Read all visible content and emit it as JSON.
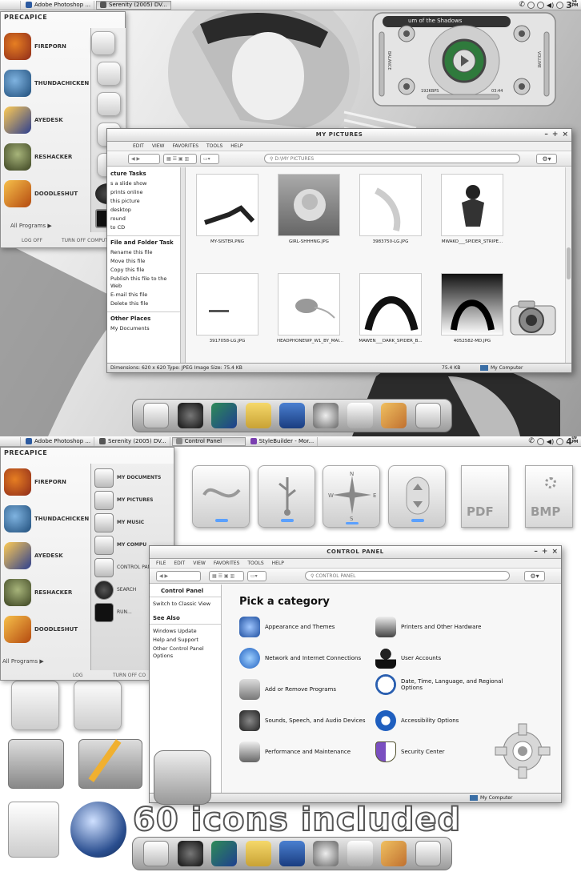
{
  "top": {
    "taskbar": {
      "items": [
        "Adobe Photoshop ...",
        "Serenity (2005) DV..."
      ],
      "clock": {
        "hour": "3",
        "minutes": "54",
        "ampm": "PM"
      }
    },
    "startmenu": {
      "title": "PRECAPICE",
      "items": [
        {
          "label": "FIREPORN",
          "color": "#c0392b"
        },
        {
          "label": "THUNDACHICKEN",
          "color": "#2e6da4"
        },
        {
          "label": "AYEDESK",
          "color": "#2d3f8f"
        },
        {
          "label": "RESHACKER",
          "color": "#6b7a3f"
        },
        {
          "label": "DOODLESHUT",
          "color": "#c66d1f"
        }
      ],
      "all_programs": "All Programs",
      "logoff": "LOG OFF",
      "turnoff": "TURN OFF COMPUTER"
    },
    "player": {
      "track": "um of the Shadows",
      "left_label": "BALANCE",
      "right_label": "VOLUME",
      "bitrate": "192KBPS",
      "time": "03:44"
    },
    "explorer": {
      "title": "MY PICTURES",
      "menu": [
        "EDIT",
        "VIEW",
        "FAVORITES",
        "TOOLS",
        "HELP"
      ],
      "address": "D:\\MY PICTURES",
      "task_heading": "cture Tasks",
      "task_links": [
        "s a slide show",
        "prints online",
        "this picture",
        "desktop",
        "round",
        "to CD"
      ],
      "ff_heading": "File and Folder Task",
      "ff_links": [
        "Rename this file",
        "Move this file",
        "Copy this file",
        "Publish this file to the Web",
        "E-mail this file",
        "Delete this file"
      ],
      "other_heading": "Other Places",
      "other_links": [
        "My Documents"
      ],
      "thumbs": [
        "MY-SISTER.PNG",
        "GIRL-SHHHNG.JPG",
        "3983750-LG.JPG",
        "MWAKO___SPIDER_STRIPE...",
        "3917058-LG.JPG",
        "HEADPHONEWP_W1_BY_MAI...",
        "MAWEN___DARK_SPIDER_B...",
        "4052582-MD.JPG"
      ],
      "status_left": "Dimensions: 620 x 620 Type: JPEG Image Size: 75.4 KB",
      "status_size": "75.4 KB",
      "status_loc": "My Computer"
    }
  },
  "bottom": {
    "taskbar": {
      "items": [
        "Adobe Photoshop ...",
        "Serenity (2005) DV...",
        "Control Panel",
        "StyleBuilder - Mor..."
      ],
      "clock": {
        "hour": "4",
        "minutes": "09",
        "ampm": "PM"
      }
    },
    "startmenu": {
      "title": "PRECAPICE",
      "items": [
        {
          "label": "FIREPORN",
          "color": "#c0392b"
        },
        {
          "label": "THUNDACHICKEN",
          "color": "#2e6da4"
        },
        {
          "label": "AYEDESK",
          "color": "#2d3f8f"
        },
        {
          "label": "RESHACKER",
          "color": "#6b7a3f"
        },
        {
          "label": "DOODLESHUT",
          "color": "#c66d1f"
        }
      ],
      "right_items": [
        "MY DOCUMENTS",
        "MY PICTURES",
        "MY MUSIC",
        "MY COMPU",
        "CONTROL PANEL",
        "SEARCH",
        "RUN..."
      ],
      "all_programs": "All Programs",
      "logoff": "LOG",
      "turnoff": "TURN OFF CO"
    },
    "file_icons": {
      "pdf": "PDF",
      "bmp": "BMP"
    },
    "control_panel": {
      "title": "CONTROL PANEL",
      "menu": [
        "FILE",
        "EDIT",
        "VIEW",
        "FAVORITES",
        "TOOLS",
        "HELP"
      ],
      "address": "CONTROL PANEL",
      "side_heading": "Control Panel",
      "switch_link": "Switch to Classic View",
      "see_also": "See Also",
      "see_links": [
        "Windows Update",
        "Help and Support",
        "Other Control Panel Options"
      ],
      "heading": "Pick a category",
      "categories": [
        "Appearance and Themes",
        "Printers and Other Hardware",
        "Network and Internet Connections",
        "User Accounts",
        "Add or Remove Programs",
        "Date, Time, Language, and Regional Options",
        "Sounds, Speech, and Audio Devices",
        "Accessibility Options",
        "Performance and Maintenance",
        "Security Center"
      ],
      "status": "My Computer"
    },
    "banner": "60 icons included"
  }
}
